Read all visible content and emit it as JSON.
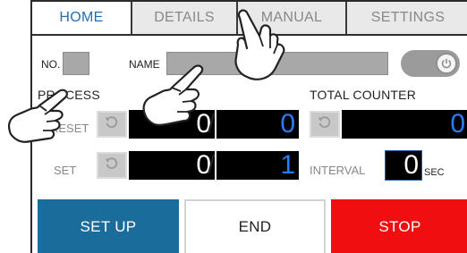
{
  "tabs": [
    {
      "label": "HOME",
      "active": true
    },
    {
      "label": "DETAILS",
      "active": false
    },
    {
      "label": "MANUAL",
      "active": false
    },
    {
      "label": "SETTINGS",
      "active": false
    }
  ],
  "fields": {
    "no_label": "NO.",
    "name_label": "NAME"
  },
  "process": {
    "title": "PROCESS",
    "reset_label": "RESET",
    "set_label": "SET",
    "reset_current": "0",
    "reset_target": "0",
    "set_current": "0",
    "set_target": "1"
  },
  "total_counter": {
    "title": "TOTAL COUNTER",
    "value": "0"
  },
  "interval": {
    "label": "INTERVAL",
    "value": "0",
    "unit": "SEC"
  },
  "buttons": {
    "setup": "SET UP",
    "end": "END",
    "stop": "STOP"
  },
  "colors": {
    "active_tab_text": "#1f6fb5",
    "setup_button": "#1a6d9b",
    "stop_button": "#f00e10",
    "counter_blue": "#2a7bff"
  },
  "icons": [
    "power-icon",
    "reset-icon",
    "hand-pointer-icon"
  ]
}
